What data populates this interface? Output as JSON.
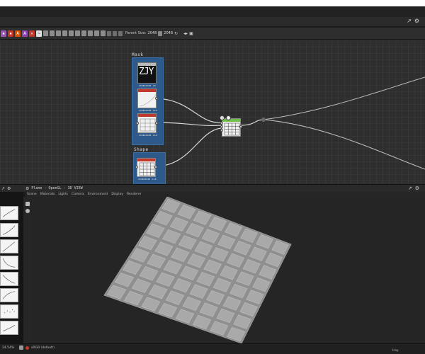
{
  "toolbar": {
    "parent_size_label": "Parent Size:",
    "width_value": "2048",
    "height_value": "2048",
    "btn_a_label": "A",
    "btn_b_label": "A"
  },
  "graph": {
    "frame_mask_title": "Mask",
    "frame_shape_title": "Shape",
    "node_zjy_text": "ZJY",
    "node1_caption": "2048x2048 - L8",
    "node2_caption": "2048x2048 - L16",
    "node3_caption": "2048x2048 - L16",
    "node4_caption": "2048x2048 - L16"
  },
  "viewport_panel": {
    "title": "Plane - OpenGL - 3D VIEW",
    "menu": [
      "Scene",
      "Materials",
      "Lights",
      "Camera",
      "Environment",
      "Display",
      "Renderer"
    ]
  },
  "status": {
    "zoom": "24.54%",
    "color_space": "sRGB (default)",
    "renderer": "Iray"
  },
  "colors": {
    "frame_blue": "#2d5a8a",
    "node_header_red": "#c0392b",
    "node_output_green": "#6fbf4a"
  }
}
